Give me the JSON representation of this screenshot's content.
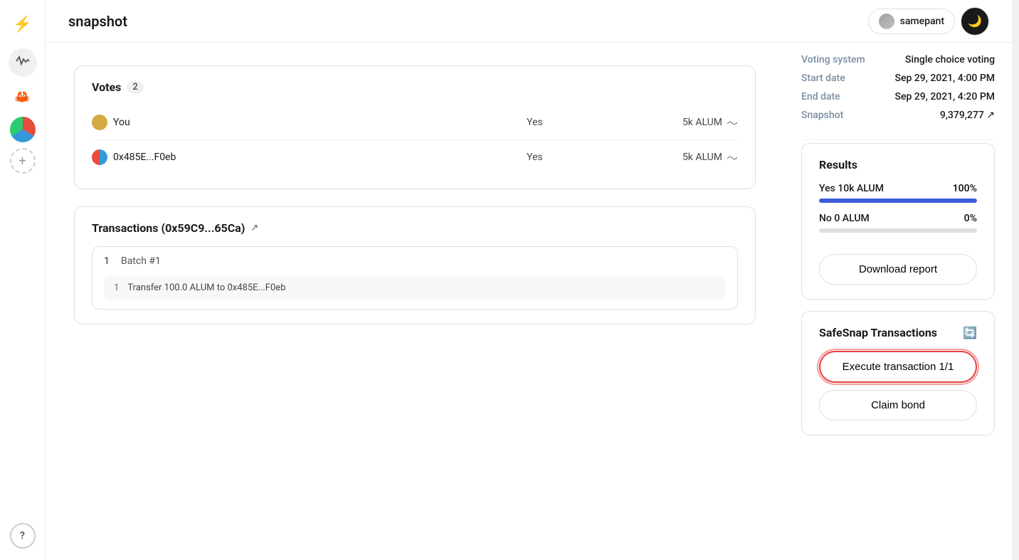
{
  "app": {
    "title": "snapshot"
  },
  "header": {
    "title": "snapshot",
    "user": "samepant",
    "dark_mode_icon": "🌙"
  },
  "sidebar": {
    "logo_icon": "⚡",
    "items": [
      {
        "id": "activity",
        "icon": "〜",
        "label": "Activity"
      },
      {
        "id": "crab",
        "icon": "🦀",
        "label": "Crab"
      },
      {
        "id": "avatar",
        "label": "DAO Avatar"
      },
      {
        "id": "add",
        "icon": "+",
        "label": "Add"
      }
    ],
    "help_label": "?"
  },
  "votes_section": {
    "title": "Votes",
    "count": "2",
    "rows": [
      {
        "voter": "You",
        "choice": "Yes",
        "amount": "5k ALUM"
      },
      {
        "voter": "0x485E...F0eb",
        "choice": "Yes",
        "amount": "5k ALUM"
      }
    ]
  },
  "transactions_section": {
    "title": "Transactions",
    "address": "(0x59C9...65Ca)",
    "external_link": "↗",
    "batches": [
      {
        "number": "1",
        "label": "Batch #1",
        "items": [
          {
            "number": "1",
            "description": "Transfer 100.0 ALUM to 0x485E...F0eb"
          }
        ]
      }
    ]
  },
  "right_panel": {
    "info_rows": [
      {
        "label": "Voting system",
        "value": "Single choice voting"
      },
      {
        "label": "Start date",
        "value": "Sep 29, 2021, 4:00 PM"
      },
      {
        "label": "End date",
        "value": "Sep 29, 2021, 4:20 PM"
      },
      {
        "label": "Snapshot",
        "value": "9,379,277 ↗"
      }
    ],
    "results": {
      "title": "Results",
      "items": [
        {
          "label": "Yes 10k ALUM",
          "pct": "100%",
          "fill": 100,
          "color": "blue"
        },
        {
          "label": "No 0 ALUM",
          "pct": "0%",
          "fill": 0,
          "color": "gray"
        }
      ],
      "download_btn": "Download report"
    },
    "safesnap": {
      "title": "SafeSnap Transactions",
      "refresh_icon": "🔄",
      "execute_btn": "Execute transaction 1/1",
      "claim_btn": "Claim bond"
    }
  }
}
